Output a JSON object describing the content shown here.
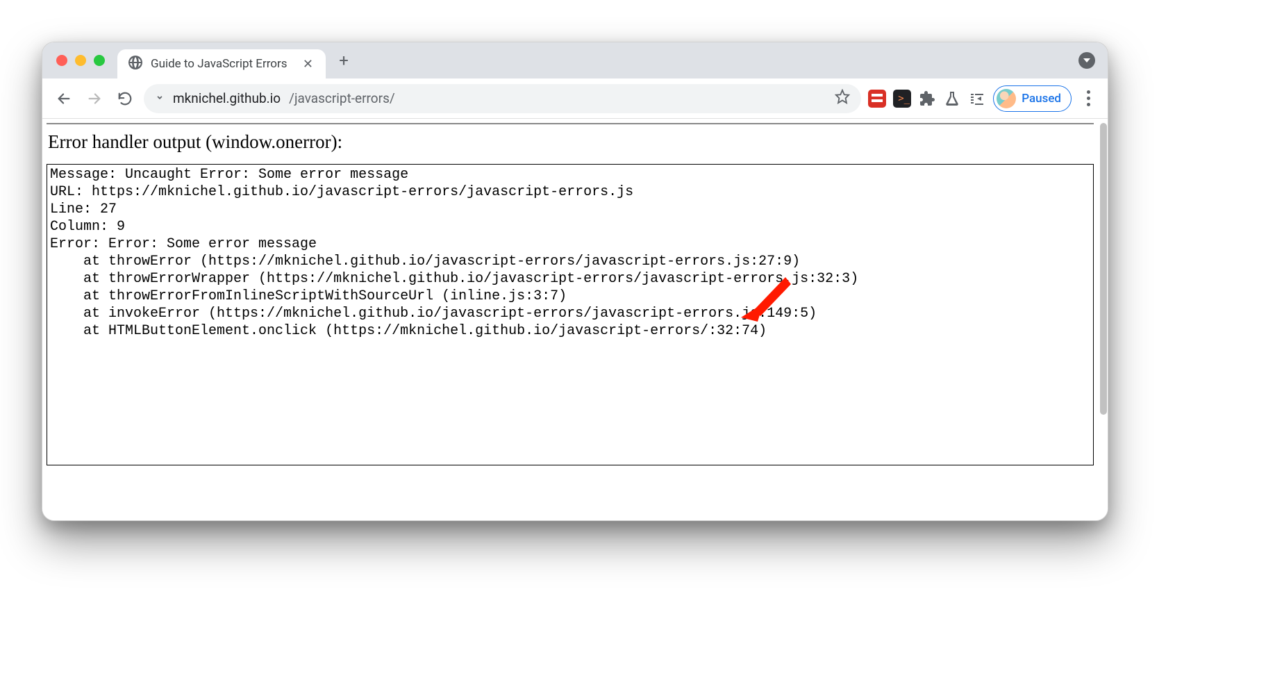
{
  "tab": {
    "title": "Guide to JavaScript Errors"
  },
  "toolbar": {
    "url_host": "mknichel.github.io",
    "url_path": "/javascript-errors/",
    "profile_label": "Paused"
  },
  "page": {
    "heading": "Error handler output (window.onerror):",
    "output": "Message: Uncaught Error: Some error message\nURL: https://mknichel.github.io/javascript-errors/javascript-errors.js\nLine: 27\nColumn: 9\nError: Error: Some error message\n    at throwError (https://mknichel.github.io/javascript-errors/javascript-errors.js:27:9)\n    at throwErrorWrapper (https://mknichel.github.io/javascript-errors/javascript-errors.js:32:3)\n    at throwErrorFromInlineScriptWithSourceUrl (inline.js:3:7)\n    at invokeError (https://mknichel.github.io/javascript-errors/javascript-errors.js:149:5)\n    at HTMLButtonElement.onclick (https://mknichel.github.io/javascript-errors/:32:74)"
  }
}
